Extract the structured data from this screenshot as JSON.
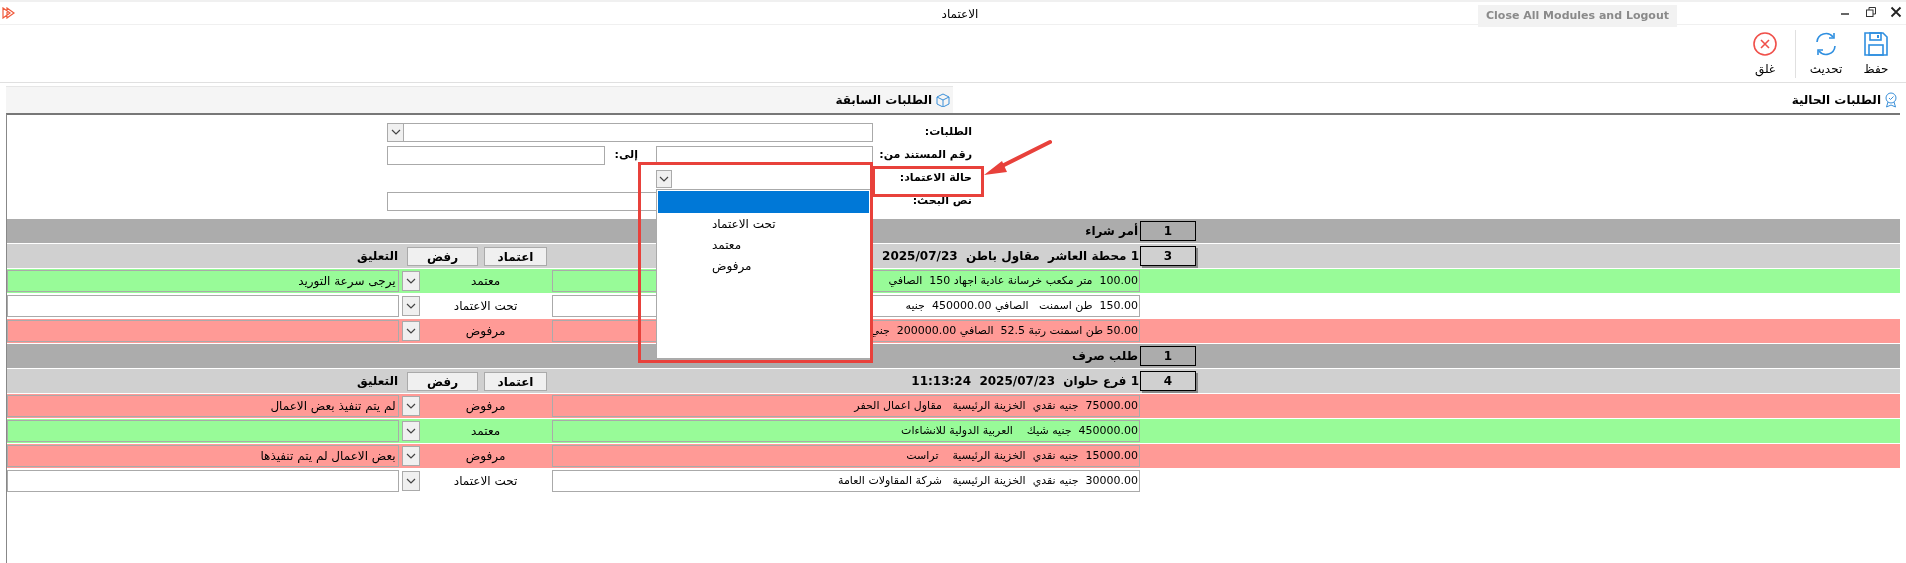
{
  "window": {
    "title": "الاعتماد",
    "tooltip": "Close All Modules and Logout"
  },
  "toolbar": [
    {
      "kind": "save",
      "label": "حفظ"
    },
    {
      "kind": "refresh",
      "label": "تحديث"
    },
    {
      "kind": "close",
      "label": "غلق"
    }
  ],
  "tabs": [
    {
      "label": "الطلبات الحالية",
      "selected": true
    },
    {
      "label": "الطلبات السابقة",
      "selected": false
    }
  ],
  "filters": {
    "requests_label": "الطلبات:",
    "doc_from_label": "رقم المستند من:",
    "to_label": "إلى:",
    "status_label": "حالة الاعتماد:",
    "search_label": "نص البحث:",
    "status_dropdown": {
      "expanded": true,
      "options": [
        {
          "selected": true
        },
        {
          "label": "تحت الاعتماد",
          "selected": false
        },
        {
          "label": "معتمد",
          "selected": false
        },
        {
          "label": "مرفوض",
          "selected": false
        }
      ]
    }
  },
  "groups": [
    {
      "title": "أمر شراء",
      "count": "1",
      "subgroups": [
        {
          "title": "1 محطة العاشر  مقاول باطن  2025/07/23",
          "count": "3",
          "approve_label": "اعتماد",
          "reject_label": "رفض",
          "comment_header": "التعليق",
          "rows": [
            {
              "description": "100.00  متر مكعب خرسانة عادية اجهاد 150  الصافي",
              "color": "#98fb98",
              "status": "معتمد",
              "comment": "يرجى سرعة التوريد"
            },
            {
              "description": "150.00  طن اسمنت   الصافي 450000.00  جنيه",
              "color": "#ffffff",
              "status": "تحت الاعتماد"
            },
            {
              "description": "50.00 طن اسمنت رتبة 52.5  الصافي 200000.00  جني",
              "color": "#ff9a96",
              "status": "مرفوض"
            }
          ]
        }
      ]
    },
    {
      "title": "طلب صرف",
      "count": "1",
      "subgroups": [
        {
          "title": "1 فرع حلوان  2025/07/23  11:13:24",
          "count": "4",
          "approve_label": "اعتماد",
          "reject_label": "رفض",
          "comment_header": "التعليق",
          "rows": [
            {
              "description": "75000.00  جنيه نقدي  الخزينة الرئيسية   مقاول اعمال الحفر",
              "color": "#ff9a96",
              "status": "مرفوض",
              "comment": "لم يتم تنفيذ بعض الاعمال"
            },
            {
              "description": "450000.00  جنيه شيك    العربية الدولية للانشاءات",
              "color": "#98fb98",
              "status": "معتمد"
            },
            {
              "description": "15000.00  جنيه نقدي  الخزينة الرئيسية    تراست",
              "color": "#ff9a96",
              "status": "مرفوض",
              "comment": "بعض الاعمال لم يتم تنفيذها"
            },
            {
              "description": "30000.00  جنيه نقدي  الخزينة الرئيسية   شركة المقاولات العامة",
              "color": "#ffffff",
              "status": "تحت الاعتماد"
            }
          ]
        }
      ]
    }
  ],
  "annotation": {
    "kind": "arrow-callout"
  }
}
